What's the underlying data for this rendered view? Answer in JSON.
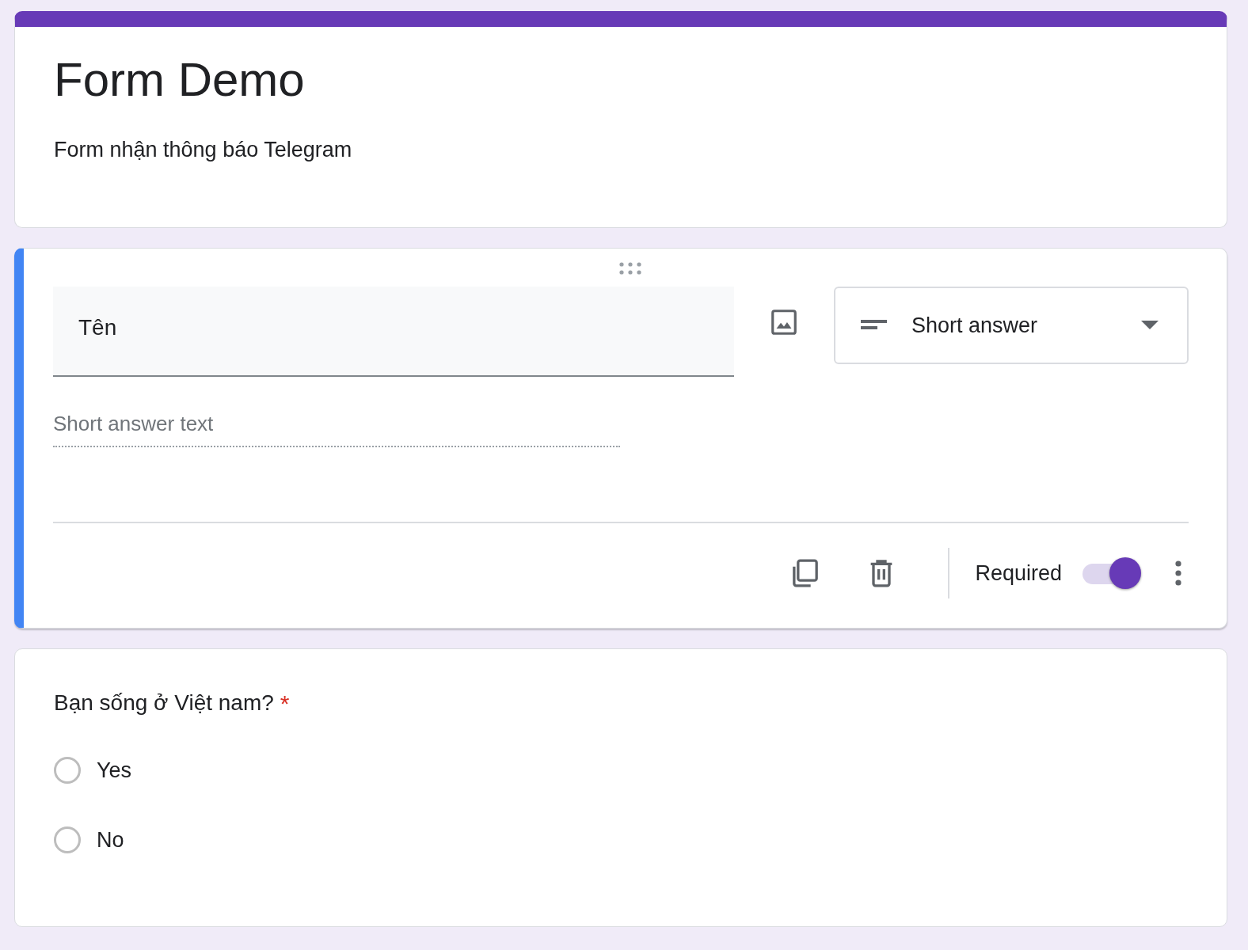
{
  "form": {
    "title": "Form Demo",
    "description": "Form nhận thông báo Telegram"
  },
  "editing_question": {
    "title": "Tên",
    "type_label": "Short answer",
    "answer_placeholder": "Short answer text",
    "required_label": "Required",
    "required": true
  },
  "question": {
    "title": "Bạn sống ở Việt nam?",
    "required": true,
    "required_mark": "*",
    "options": [
      {
        "label": "Yes",
        "selected": false
      },
      {
        "label": "No",
        "selected": false
      }
    ]
  }
}
